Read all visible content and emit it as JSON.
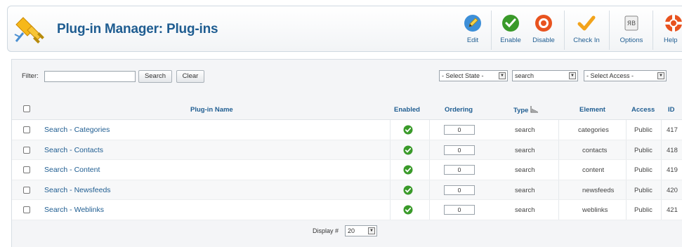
{
  "header": {
    "title": "Plug-in Manager: Plug-ins",
    "toolbar": [
      {
        "label": "Edit",
        "icon": "pencil-icon"
      },
      {
        "label": "Enable",
        "icon": "enable-check-icon"
      },
      {
        "label": "Disable",
        "icon": "disable-icon"
      },
      {
        "label": "Check In",
        "icon": "checkin-icon"
      },
      {
        "label": "Options",
        "icon": "options-icon"
      },
      {
        "label": "Help",
        "icon": "help-icon"
      }
    ]
  },
  "filter": {
    "label": "Filter:",
    "value": "",
    "search_label": "Search",
    "clear_label": "Clear",
    "state_select": "- Select State -",
    "folder_select": "search",
    "access_select": "- Select Access -"
  },
  "table": {
    "columns": {
      "name": "Plug-in Name",
      "enabled": "Enabled",
      "ordering": "Ordering",
      "type": "Type",
      "element": "Element",
      "access": "Access",
      "id": "ID"
    },
    "rows": [
      {
        "name": "Search - Categories",
        "ordering": "0",
        "type": "search",
        "element": "categories",
        "access": "Public",
        "id": "417",
        "enabled": true
      },
      {
        "name": "Search - Contacts",
        "ordering": "0",
        "type": "search",
        "element": "contacts",
        "access": "Public",
        "id": "418",
        "enabled": true
      },
      {
        "name": "Search - Content",
        "ordering": "0",
        "type": "search",
        "element": "content",
        "access": "Public",
        "id": "419",
        "enabled": true
      },
      {
        "name": "Search - Newsfeeds",
        "ordering": "0",
        "type": "search",
        "element": "newsfeeds",
        "access": "Public",
        "id": "420",
        "enabled": true
      },
      {
        "name": "Search - Weblinks",
        "ordering": "0",
        "type": "search",
        "element": "weblinks",
        "access": "Public",
        "id": "421",
        "enabled": true
      }
    ]
  },
  "footer": {
    "display_label": "Display #",
    "display_value": "20"
  },
  "colors": {
    "link": "#1f5d91",
    "enabled_green": "#3a9a2a",
    "disable_orange": "#e8531f",
    "checkin_orange": "#f2a31b"
  }
}
